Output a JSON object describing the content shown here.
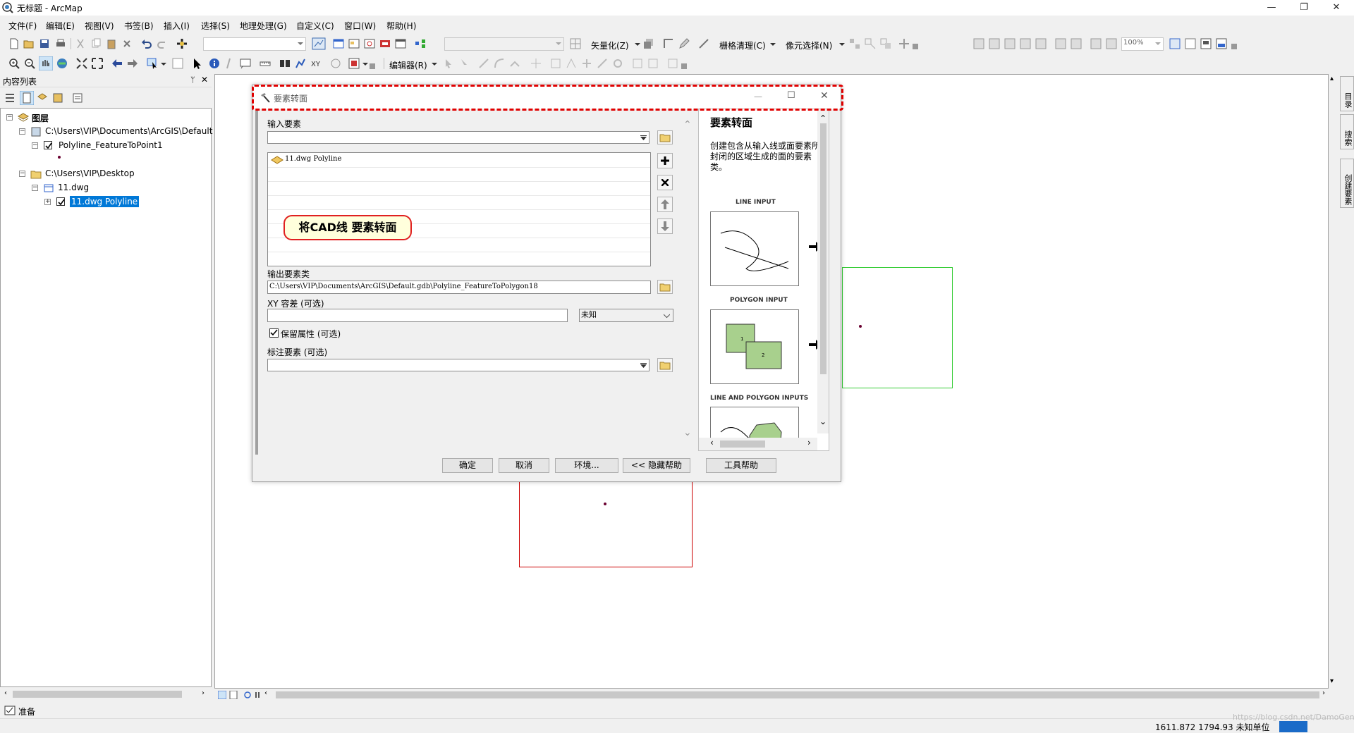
{
  "window": {
    "title": "无标题 - ArcMap",
    "minimize": "—",
    "restore": "❐",
    "close": "✕"
  },
  "menu": [
    "文件(F)",
    "编辑(E)",
    "视图(V)",
    "书签(B)",
    "插入(I)",
    "选择(S)",
    "地理处理(G)",
    "自定义(C)",
    "窗口(W)",
    "帮助(H)"
  ],
  "toolbar": {
    "vectorize_label": "矢量化(Z)",
    "raster_cleanup_label": "栅格清理(C)",
    "cell_select_label": "像元选择(N)",
    "zoom_value": "100%",
    "editor_label": "编辑器(R)"
  },
  "toc": {
    "title": "内容列表",
    "pin": "ᛘ",
    "close": "✕",
    "layers_label": "图层",
    "tree": [
      {
        "label": "C:\\Users\\VIP\\Documents\\ArcGIS\\Default",
        "level": 1,
        "type": "gdb"
      },
      {
        "label": "Polyline_FeatureToPoint1",
        "level": 2,
        "type": "layer",
        "checked": true
      },
      {
        "label": "C:\\Users\\VIP\\Desktop",
        "level": 1,
        "type": "folder"
      },
      {
        "label": "11.dwg",
        "level": 2,
        "type": "dwg"
      },
      {
        "label": "11.dwg Polyline",
        "level": 3,
        "type": "layer",
        "checked": true,
        "selected": true
      }
    ]
  },
  "dialog": {
    "title": "要素转面",
    "input_features_label": "输入要素",
    "input_features_value": "",
    "list_items": [
      "11.dwg Polyline"
    ],
    "output_label": "输出要素类",
    "output_value": "C:\\Users\\VIP\\Documents\\ArcGIS\\Default.gdb\\Polyline_FeatureToPolygon18",
    "xy_tolerance_label": "XY 容差 (可选)",
    "xy_tolerance_value": "",
    "unit_value": "未知",
    "preserve_attr_label": "保留属性 (可选)",
    "preserve_attr_checked": true,
    "label_features_label": "标注要素 (可选)",
    "label_features_value": "",
    "callout": "将CAD线 要素转面",
    "buttons": {
      "ok": "确定",
      "cancel": "取消",
      "env": "环境...",
      "hide_help": "<< 隐藏帮助",
      "tool_help": "工具帮助"
    },
    "help": {
      "title": "要素转面",
      "description": "创建包含从输入线或面要素所封闭的区域生成的面的要素类。",
      "cap_line": "LINE INPUT",
      "cap_polygon": "POLYGON INPUT",
      "cap_both": "LINE AND POLYGON INPUTS"
    }
  },
  "right_dock": [
    "目录",
    "搜索",
    "创建要素"
  ],
  "status": {
    "ready": "准备",
    "coords": "1611.872  1794.93 未知单位",
    "watermark": "https://blog.csdn.net/DamoGenu"
  },
  "colors": {
    "highlight_border": "#e00000",
    "selection": "#0078d7",
    "green_box": "#33cc33",
    "red_box": "#cc0000",
    "help_fill": "#a8d08d"
  }
}
